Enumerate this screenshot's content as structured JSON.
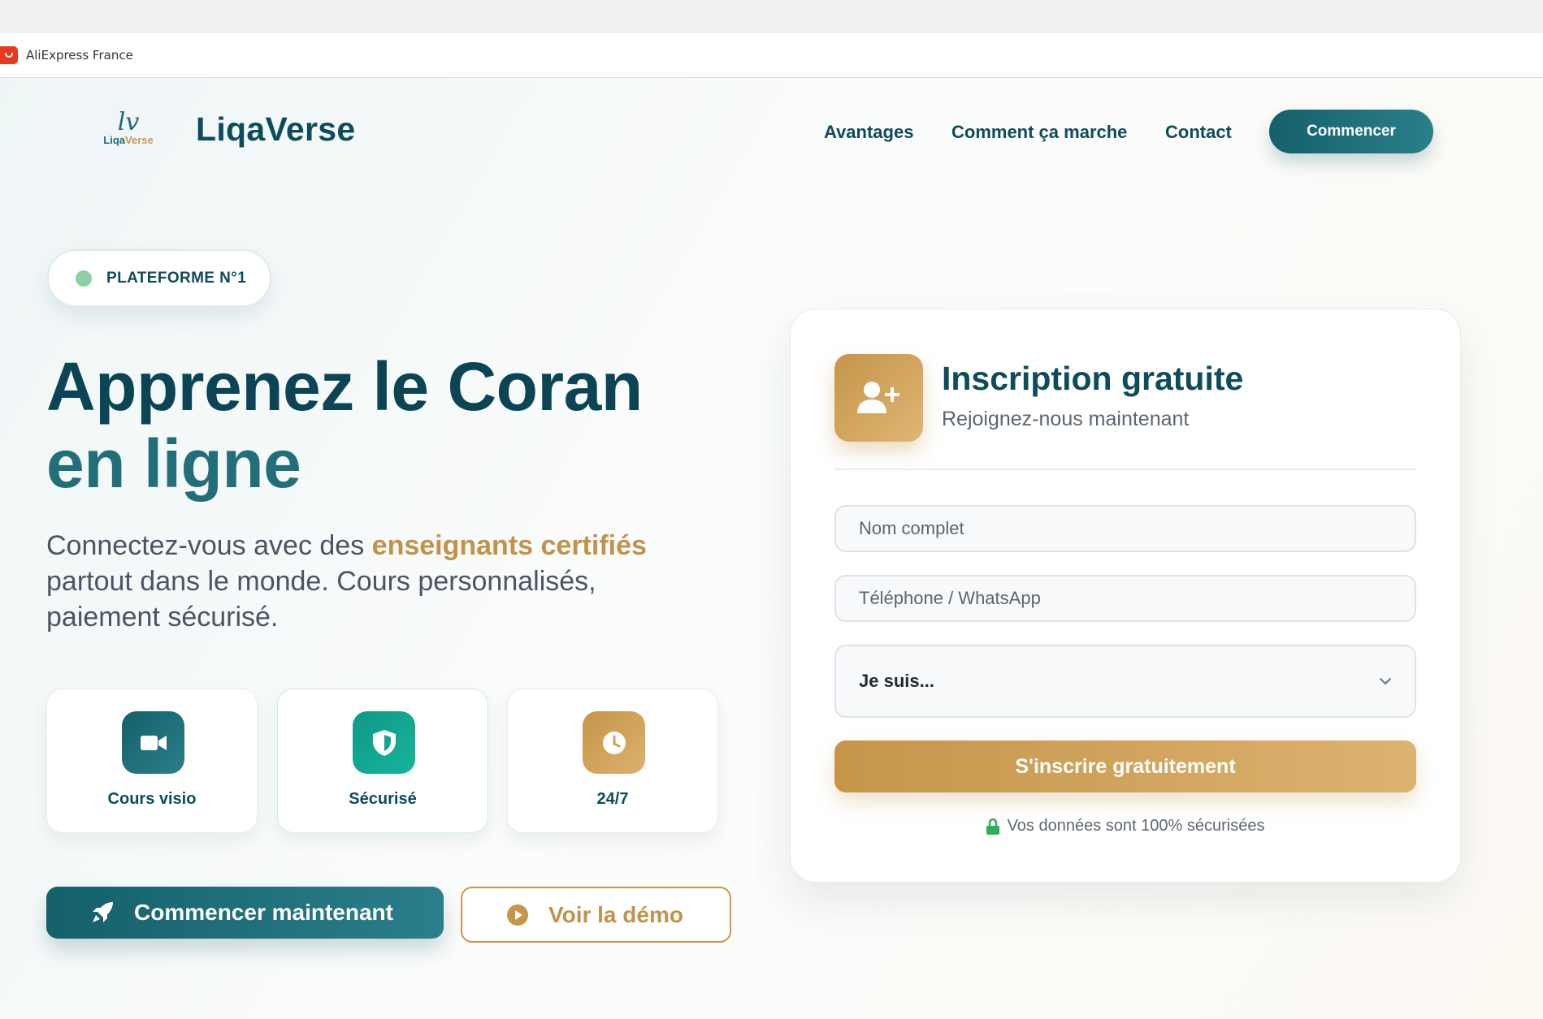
{
  "bookmark": {
    "label": "AliExpress France"
  },
  "header": {
    "logo_letters": "lv",
    "logo_word_1": "Liqa",
    "logo_word_2": "Verse",
    "brand": "LiqaVerse",
    "nav": [
      "Avantages",
      "Comment ça marche",
      "Contact"
    ],
    "cta": "Commencer"
  },
  "badge": {
    "label": "PLATEFORME N°1"
  },
  "hero": {
    "line1": "Apprenez le Coran",
    "line2": "en ligne",
    "lead_before": "Connectez-vous avec des ",
    "lead_highlight": "enseignants certifiés",
    "lead_after": " partout dans le monde. Cours personnalisés, paiement sécurisé."
  },
  "features": [
    {
      "label": "Cours visio",
      "icon": "video-camera-icon"
    },
    {
      "label": "Sécurisé",
      "icon": "shield-icon"
    },
    {
      "label": "24/7",
      "icon": "clock-icon"
    }
  ],
  "actions": {
    "primary": "Commencer maintenant",
    "secondary": "Voir la démo"
  },
  "form": {
    "title": "Inscription gratuite",
    "subtitle": "Rejoignez-nous maintenant",
    "name_placeholder": "Nom complet",
    "phone_placeholder": "Téléphone / WhatsApp",
    "role_selected": "Je suis...",
    "submit": "S'inscrire gratuitement",
    "secure_note": "Vos données sont 100% sécurisées"
  },
  "colors": {
    "primary_teal": "#14606b",
    "accent_gold": "#c5954a",
    "green_shield": "#0f9a85",
    "badge_dot": "#8fd0a6"
  }
}
